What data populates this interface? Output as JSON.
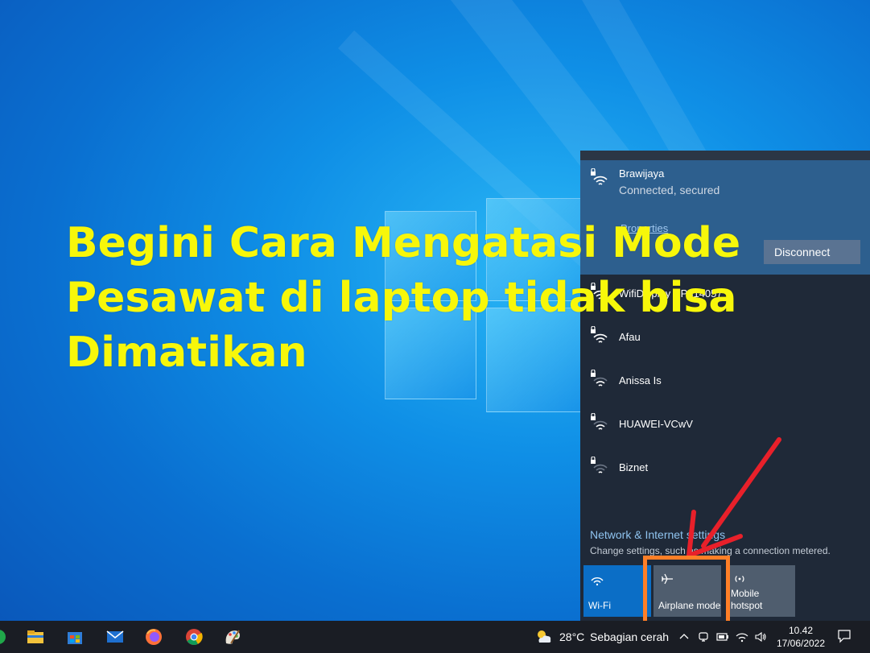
{
  "headline": {
    "line1": "Begini Cara Mengatasi Mode",
    "line2": "Pesawat di laptop tidak bisa",
    "line3": "Dimatikan"
  },
  "network_flyout": {
    "connected_network": {
      "name": "Brawijaya",
      "status": "Connected, secured",
      "properties_link": "Properties",
      "disconnect_button": "Disconnect"
    },
    "networks": [
      {
        "name": "WifiDisplay BP314057"
      },
      {
        "name": "Afau"
      },
      {
        "name": "Anissa Is"
      },
      {
        "name": "HUAWEI-VCwV"
      },
      {
        "name": "Biznet"
      }
    ],
    "settings_link": "Network & Internet settings",
    "settings_sub": "Change settings, such as making a connection metered.",
    "quick_actions": [
      {
        "label": "Wi-Fi",
        "icon": "wifi-icon",
        "active": true
      },
      {
        "label": "Airplane mode",
        "icon": "airplane-icon",
        "active": false
      },
      {
        "label": "Mobile hotspot",
        "icon": "hotspot-icon",
        "active": false
      }
    ]
  },
  "taskbar": {
    "apps": [
      "file-explorer-icon",
      "store-icon",
      "mail-icon",
      "firefox-icon",
      "chrome-icon",
      "paint-icon"
    ],
    "weather_temp": "28°C",
    "weather_desc": "Sebagian cerah",
    "time": "10.42",
    "date": "17/06/2022"
  },
  "colors": {
    "headline": "#f7f70a",
    "highlight_box": "#ff7f27",
    "arrow": "#e8202a",
    "flyout_bg": "#1f2938",
    "connected_bg": "#2d5f8e",
    "accent": "#0b6ec6"
  }
}
